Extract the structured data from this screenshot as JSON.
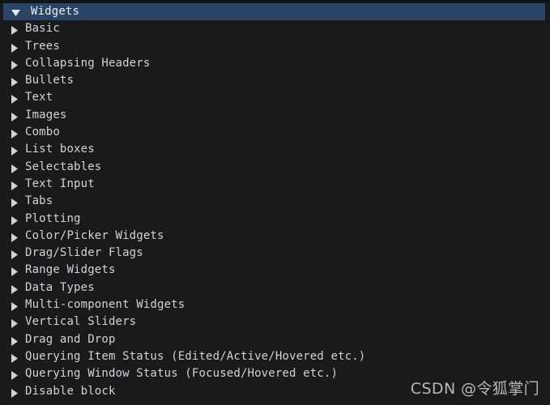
{
  "window": {
    "title": "Widgets",
    "background_color": "#1a1a1d",
    "text_color": "#d2d3d6",
    "selection_color": "#2a4566"
  },
  "tree": {
    "root": {
      "label": "Widgets",
      "state": "open",
      "arrow_icon": "triangle-down-icon",
      "selected": true
    },
    "items": [
      {
        "label": "Basic",
        "state": "closed",
        "arrow_icon": "triangle-right-icon"
      },
      {
        "label": "Trees",
        "state": "closed",
        "arrow_icon": "triangle-right-icon"
      },
      {
        "label": "Collapsing Headers",
        "state": "closed",
        "arrow_icon": "triangle-right-icon"
      },
      {
        "label": "Bullets",
        "state": "closed",
        "arrow_icon": "triangle-right-icon"
      },
      {
        "label": "Text",
        "state": "closed",
        "arrow_icon": "triangle-right-icon"
      },
      {
        "label": "Images",
        "state": "closed",
        "arrow_icon": "triangle-right-icon"
      },
      {
        "label": "Combo",
        "state": "closed",
        "arrow_icon": "triangle-right-icon"
      },
      {
        "label": "List boxes",
        "state": "closed",
        "arrow_icon": "triangle-right-icon"
      },
      {
        "label": "Selectables",
        "state": "closed",
        "arrow_icon": "triangle-right-icon"
      },
      {
        "label": "Text Input",
        "state": "closed",
        "arrow_icon": "triangle-right-icon"
      },
      {
        "label": "Tabs",
        "state": "closed",
        "arrow_icon": "triangle-right-icon"
      },
      {
        "label": "Plotting",
        "state": "closed",
        "arrow_icon": "triangle-right-icon"
      },
      {
        "label": "Color/Picker Widgets",
        "state": "closed",
        "arrow_icon": "triangle-right-icon"
      },
      {
        "label": "Drag/Slider Flags",
        "state": "closed",
        "arrow_icon": "triangle-right-icon"
      },
      {
        "label": "Range Widgets",
        "state": "closed",
        "arrow_icon": "triangle-right-icon"
      },
      {
        "label": "Data Types",
        "state": "closed",
        "arrow_icon": "triangle-right-icon"
      },
      {
        "label": "Multi-component Widgets",
        "state": "closed",
        "arrow_icon": "triangle-right-icon"
      },
      {
        "label": "Vertical Sliders",
        "state": "closed",
        "arrow_icon": "triangle-right-icon"
      },
      {
        "label": "Drag and Drop",
        "state": "closed",
        "arrow_icon": "triangle-right-icon"
      },
      {
        "label": "Querying Item Status (Edited/Active/Hovered etc.)",
        "state": "closed",
        "arrow_icon": "triangle-right-icon"
      },
      {
        "label": "Querying Window Status (Focused/Hovered etc.)",
        "state": "closed",
        "arrow_icon": "triangle-right-icon"
      },
      {
        "label": "Disable block",
        "state": "closed",
        "arrow_icon": "triangle-right-icon"
      }
    ]
  },
  "watermark": {
    "text": "CSDN @令狐掌门"
  }
}
